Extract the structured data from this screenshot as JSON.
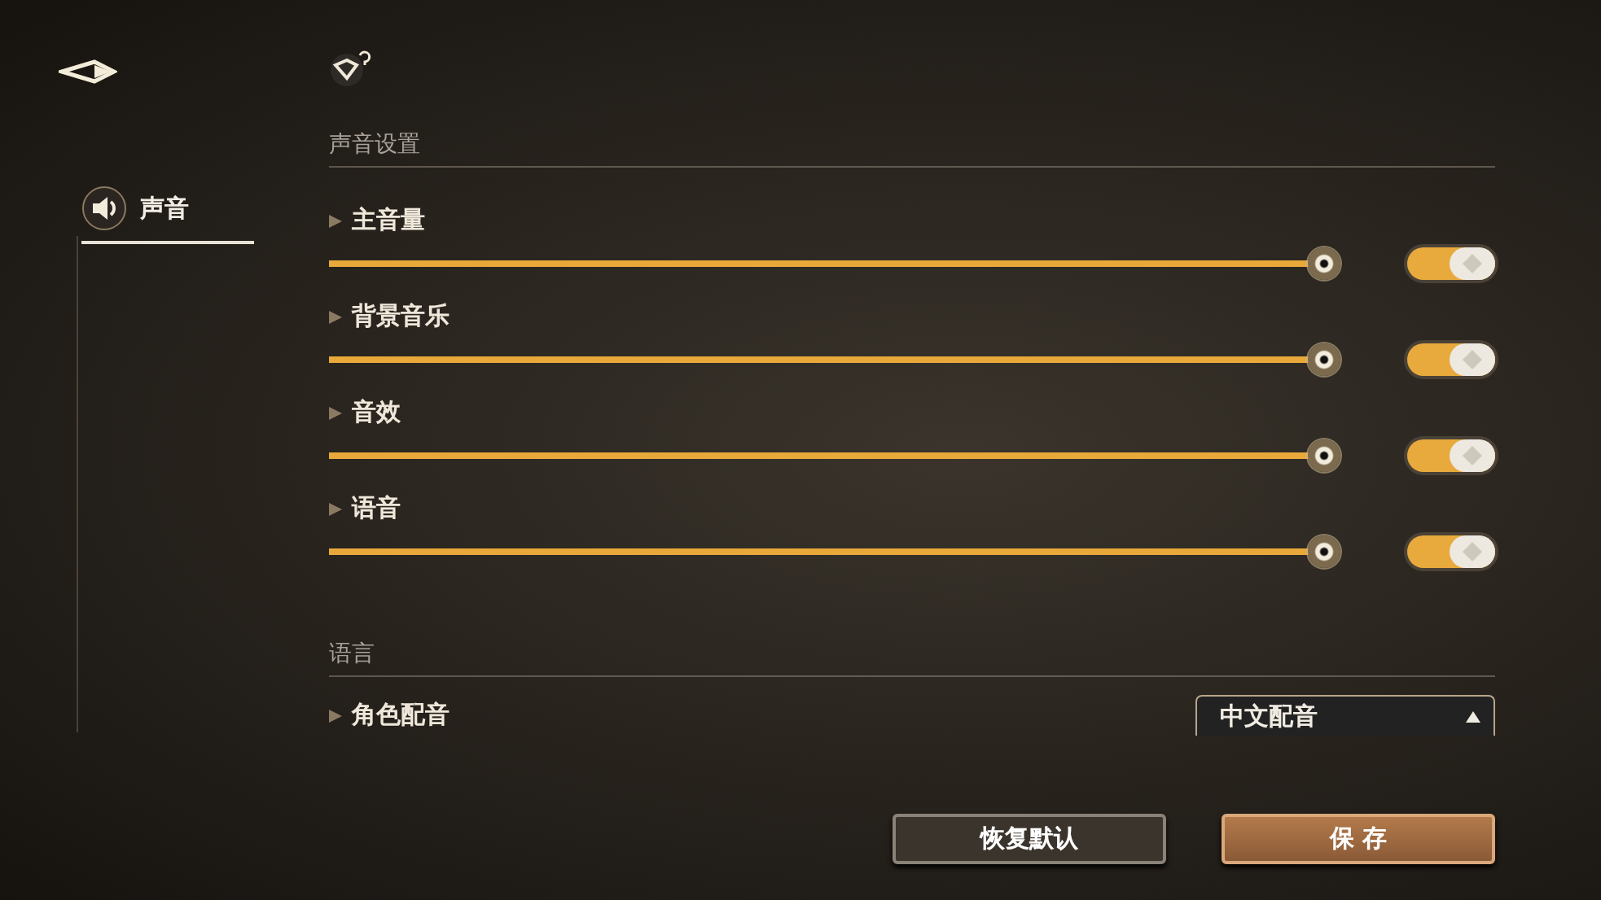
{
  "nav": {
    "items": [
      {
        "label": "声音",
        "selected": true
      }
    ]
  },
  "sections": [
    {
      "title": "声音设置",
      "rows": [
        {
          "kind": "slider",
          "label": "主音量",
          "level": 1,
          "on": true
        },
        {
          "kind": "slider",
          "label": "背景音乐",
          "level": 1,
          "on": true
        },
        {
          "kind": "slider",
          "label": "音效",
          "level": 1,
          "on": true
        },
        {
          "kind": "slider",
          "label": "语音",
          "level": 1,
          "on": true
        }
      ]
    },
    {
      "title": "语言",
      "rows": [
        {
          "kind": "dropdown",
          "label": "角色配音",
          "value": "中文配音"
        }
      ]
    }
  ],
  "buttons": [
    {
      "label": "恢复默认",
      "primary": false
    },
    {
      "label": "保 存",
      "primary": true
    }
  ]
}
